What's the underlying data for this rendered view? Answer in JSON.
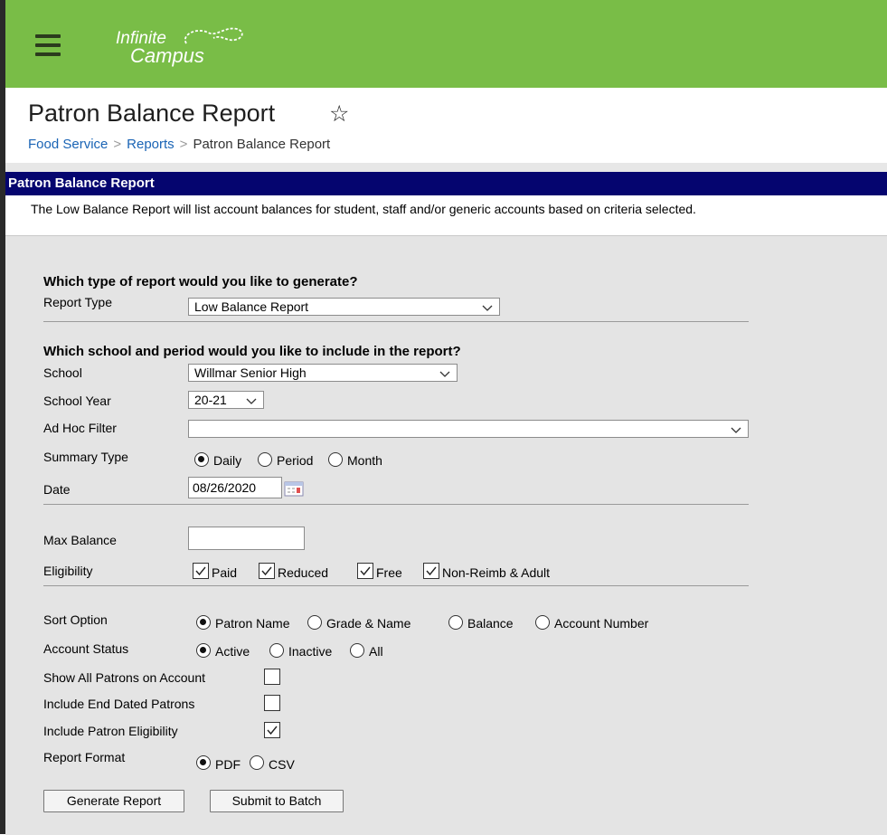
{
  "header": {
    "logo_line1": "Infinite",
    "logo_line2": "Campus"
  },
  "page": {
    "title": "Patron Balance Report",
    "breadcrumbs": [
      "Food Service",
      "Reports",
      "Patron Balance Report"
    ]
  },
  "panel": {
    "title": "Patron Balance Report",
    "description": "The Low Balance Report will list account balances for student, staff and/or generic accounts based on criteria selected."
  },
  "form": {
    "section_report": "Which type of report would you like to generate?",
    "report_type_label": "Report Type",
    "report_type_value": "Low Balance Report",
    "section_school": "Which school and period would you like to include in the report?",
    "school_label": "School",
    "school_value": "Willmar Senior High",
    "school_year_label": "School Year",
    "school_year_value": "20-21",
    "adhoc_label": "Ad Hoc Filter",
    "adhoc_value": "",
    "summary_label": "Summary Type",
    "summary_options": [
      "Daily",
      "Period",
      "Month"
    ],
    "summary_selected": "Daily",
    "date_label": "Date",
    "date_value": "08/26/2020",
    "max_balance_label": "Max Balance",
    "max_balance_value": "",
    "eligibility_label": "Eligibility",
    "eligibility_options": [
      "Paid",
      "Reduced",
      "Free",
      "Non-Reimb & Adult"
    ],
    "eligibility_checked": [
      true,
      true,
      true,
      true
    ],
    "sort_label": "Sort Option",
    "sort_options": [
      "Patron Name",
      "Grade & Name",
      "Balance",
      "Account Number"
    ],
    "sort_selected": "Patron Name",
    "status_label": "Account Status",
    "status_options": [
      "Active",
      "Inactive",
      "All"
    ],
    "status_selected": "Active",
    "show_all_label": "Show All Patrons on Account",
    "show_all_checked": false,
    "end_dated_label": "Include End Dated Patrons",
    "end_dated_checked": false,
    "patron_elig_label": "Include Patron Eligibility",
    "patron_elig_checked": true,
    "format_label": "Report Format",
    "format_options": [
      "PDF",
      "CSV"
    ],
    "format_selected": "PDF"
  },
  "buttons": {
    "generate": "Generate Report",
    "batch": "Submit to Batch"
  },
  "colors": {
    "topbar": "#79bd47",
    "panel_header": "#05056f",
    "link": "#1a64b5",
    "form_bg": "#e4e4e4"
  }
}
